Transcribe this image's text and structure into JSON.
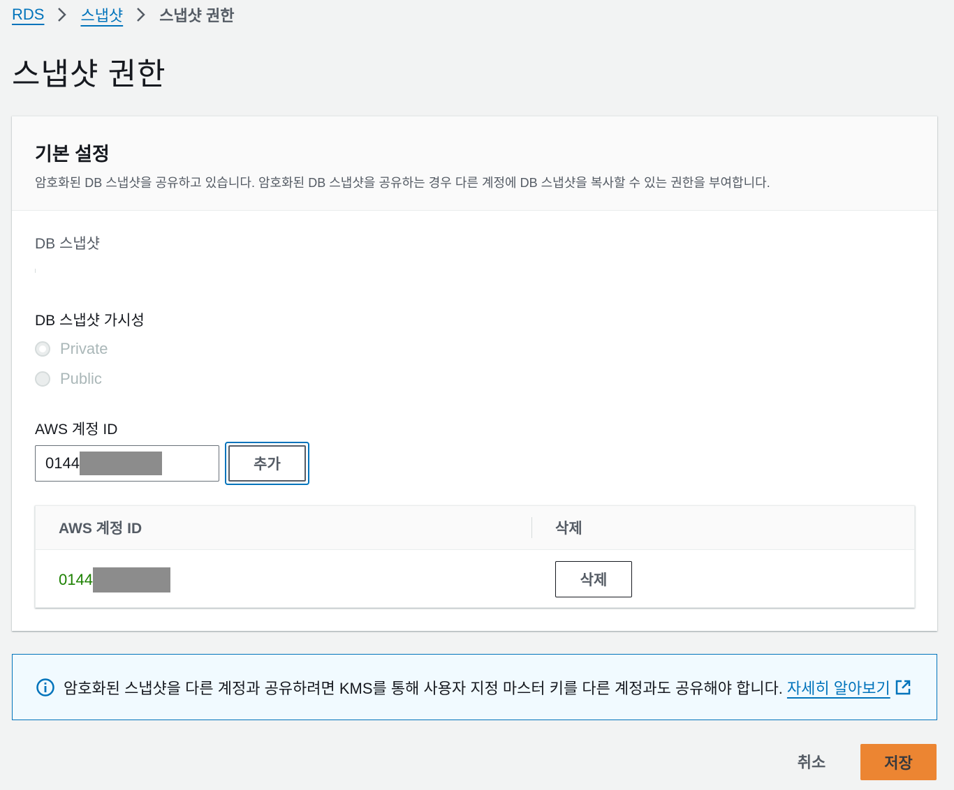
{
  "breadcrumb": {
    "items": [
      "RDS",
      "스냅샷"
    ],
    "current": "스냅샷 권한"
  },
  "page": {
    "title": "스냅샷 권한"
  },
  "panel": {
    "title": "기본 설정",
    "description": "암호화된 DB 스냅샷을 공유하고 있습니다. 암호화된 DB 스냅샷을 공유하는 경우 다른 계정에 DB 스냅샷을 복사할 수 있는 권한을 부여합니다."
  },
  "snapshot": {
    "label": "DB 스냅샷"
  },
  "visibility": {
    "label": "DB 스냅샷 가시성",
    "options": [
      {
        "label": "Private",
        "selected": true,
        "disabled": true
      },
      {
        "label": "Public",
        "selected": false,
        "disabled": true
      }
    ]
  },
  "account": {
    "label": "AWS 계정 ID",
    "input_value": "0144",
    "add_label": "추가"
  },
  "table": {
    "headers": [
      "AWS 계정 ID",
      "삭제"
    ],
    "rows": [
      {
        "account_id": "0144",
        "delete_label": "삭제"
      }
    ]
  },
  "alert": {
    "text": "암호화된 스냅샷을 다른 계정과 공유하려면 KMS를 통해 사용자 지정 마스터 키를 다른 계정과도 공유해야 합니다.",
    "link": "자세히 알아보기"
  },
  "footer": {
    "cancel_label": "취소",
    "save_label": "저장"
  },
  "colors": {
    "accent": "#0073bb",
    "primary": "#ec7211",
    "success": "#1d8102"
  }
}
